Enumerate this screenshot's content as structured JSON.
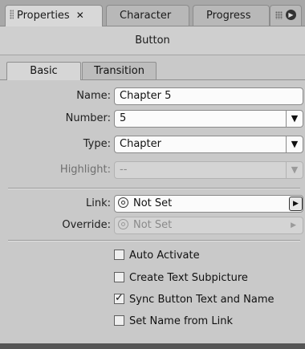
{
  "panel_tabs": {
    "properties": "Properties",
    "character": "Character",
    "progress": "Progress"
  },
  "title": "Button",
  "sub_tabs": {
    "basic": "Basic",
    "transition": "Transition"
  },
  "fields": {
    "name": {
      "label": "Name:",
      "value": "Chapter 5"
    },
    "number": {
      "label": "Number:",
      "value": "5"
    },
    "type": {
      "label": "Type:",
      "value": "Chapter"
    },
    "highlight": {
      "label": "Highlight:",
      "value": "--"
    },
    "link": {
      "label": "Link:",
      "value": "Not Set"
    },
    "override": {
      "label": "Override:",
      "value": "Not Set"
    }
  },
  "checkboxes": {
    "auto_activate": {
      "label": "Auto Activate",
      "checked": false
    },
    "create_text_subpicture": {
      "label": "Create Text Subpicture",
      "checked": false
    },
    "sync_button_text": {
      "label": "Sync Button Text and Name",
      "checked": true
    },
    "set_name_from_link": {
      "label": "Set Name from Link",
      "checked": false
    }
  },
  "icons": {
    "close": "close-icon",
    "panel_menu": "panel-menu-icon",
    "pickwhip": "pickwhip-icon",
    "dropdown": "chevron-down-icon",
    "arrow_right": "arrow-right-icon"
  },
  "colors": {
    "panel_bg": "#c9c9c9",
    "tabbar_bg": "#a8a8a8",
    "field_bg": "#fbfbfb"
  }
}
